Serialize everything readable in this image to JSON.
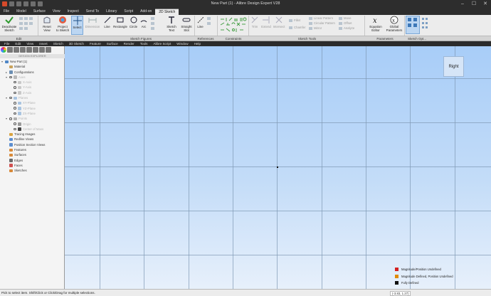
{
  "window": {
    "title": "New Part (1) - Alibre Design Expert V28",
    "controls": [
      "–",
      "☐",
      "✕"
    ]
  },
  "ribbon_tabs": [
    "File",
    "Model",
    "Surface",
    "View",
    "Inspect",
    "Send To",
    "Library",
    "Script",
    "Add-on",
    "2D Sketch"
  ],
  "active_tab": "2D Sketch",
  "ribbon": {
    "deactivate": [
      "Deactivate",
      "Sketch"
    ],
    "reset_view": [
      "Reset",
      "View"
    ],
    "project": [
      "Project",
      "to Sketch"
    ],
    "select": "Select",
    "dimension": "Dimension",
    "line": "Line",
    "rectangle": "Rectangle",
    "circle": "Circle",
    "arc": "Arc",
    "sketch_text": [
      "Sketch",
      "Text"
    ],
    "straight_slot": [
      "Straight",
      "Slot"
    ],
    "ref_line": "Line",
    "trim": "Trim",
    "extend": "Extend",
    "intersect": "Intersect",
    "fillet": "Fillet",
    "chamfer": "Chamfer",
    "linear_pattern": "Linear Pattern",
    "circular_pattern": "Circular Pattern",
    "mirror": "Mirror",
    "move": "Move",
    "offset": "Offset",
    "analyze": "Analyze",
    "equation_editor": [
      "Equation",
      "Editor"
    ],
    "global_parameters": [
      "Global",
      "Parameters"
    ]
  },
  "ribbon_groups": [
    "Edit",
    "Sketch Figures",
    "References",
    "Constraints",
    "Sketch Tools",
    "Parameters",
    "Sketch Opt..."
  ],
  "menu": [
    "File",
    "Edit",
    "View",
    "Insert",
    "Sketch",
    "3D Sketch",
    "Feature",
    "Surface",
    "Render",
    "Tools",
    "Alibre Script",
    "Window",
    "Help"
  ],
  "panel": {
    "header": "DESIGN EXPLORER",
    "tree": [
      {
        "label": "New Part (1)",
        "level": 0,
        "exp": "▾",
        "icon": "#4f86c6",
        "eye": false,
        "dim": false
      },
      {
        "label": "Material",
        "level": 1,
        "exp": "",
        "icon": "#c9a25a",
        "eye": false,
        "dim": false
      },
      {
        "label": "Configurations",
        "level": 1,
        "exp": "▸",
        "icon": "#6c8fb3",
        "eye": false,
        "dim": false
      },
      {
        "label": "Axes",
        "level": 1,
        "exp": "▾",
        "icon": "#b8b8b8",
        "eye": true,
        "dim": true
      },
      {
        "label": "X-Axis",
        "level": 2,
        "exp": "",
        "icon": "#c8c8c8",
        "eye": true,
        "dim": true
      },
      {
        "label": "Y-Axis",
        "level": 2,
        "exp": "",
        "icon": "#c8c8c8",
        "eye": true,
        "dim": true
      },
      {
        "label": "Z-Axis",
        "level": 2,
        "exp": "",
        "icon": "#c8c8c8",
        "eye": true,
        "dim": true
      },
      {
        "label": "Planes",
        "level": 1,
        "exp": "▾",
        "icon": "#a9c4e0",
        "eye": true,
        "dim": true
      },
      {
        "label": "XY-Plane",
        "level": 2,
        "exp": "",
        "icon": "#a9c4e0",
        "eye": true,
        "dim": true
      },
      {
        "label": "YZ-Plane",
        "level": 2,
        "exp": "",
        "icon": "#a9c4e0",
        "eye": true,
        "dim": true
      },
      {
        "label": "ZX-Plane",
        "level": 2,
        "exp": "",
        "icon": "#a9c4e0",
        "eye": true,
        "dim": true
      },
      {
        "label": "Points",
        "level": 1,
        "exp": "▾",
        "icon": "#b0b0b0",
        "eye": true,
        "dim": true
      },
      {
        "label": "Origin",
        "level": 2,
        "exp": "",
        "icon": "#9a9a9a",
        "eye": true,
        "dim": true
      },
      {
        "label": "Center of Mass",
        "level": 2,
        "exp": "",
        "icon": "#444444",
        "eye": true,
        "dim": true
      },
      {
        "label": "Tracing Images",
        "level": 1,
        "exp": "",
        "icon": "#d9a441",
        "eye": false,
        "dim": false
      },
      {
        "label": "Redline Views",
        "level": 1,
        "exp": "",
        "icon": "#5d8fd0",
        "eye": false,
        "dim": false
      },
      {
        "label": "Position Section Views",
        "level": 1,
        "exp": "",
        "icon": "#5d8fd0",
        "eye": false,
        "dim": false
      },
      {
        "label": "Features",
        "level": 1,
        "exp": "",
        "icon": "#d88a3a",
        "eye": false,
        "dim": false
      },
      {
        "label": "Surfaces",
        "level": 1,
        "exp": "",
        "icon": "#d88a3a",
        "eye": false,
        "dim": false
      },
      {
        "label": "Edges",
        "level": 1,
        "exp": "",
        "icon": "#6a6a6a",
        "eye": false,
        "dim": false
      },
      {
        "label": "Faces",
        "level": 1,
        "exp": "",
        "icon": "#d05050",
        "eye": false,
        "dim": false
      },
      {
        "label": "Sketches",
        "level": 1,
        "exp": "",
        "icon": "#d88a3a",
        "eye": false,
        "dim": false
      }
    ]
  },
  "viewport": {
    "view_label": "Right",
    "legend": [
      {
        "label": "Magnitude/Position Undefined",
        "color": "#d42020"
      },
      {
        "label": "Magnitude Defined, Position Undefined",
        "color": "#e08a00"
      },
      {
        "label": "Fully Defined",
        "color": "#111111"
      }
    ]
  },
  "status": {
    "message": "Pick to select item. Shift/Click or Click/Drag for multiple selections.",
    "coords": "(-3.83, 1.27)"
  }
}
